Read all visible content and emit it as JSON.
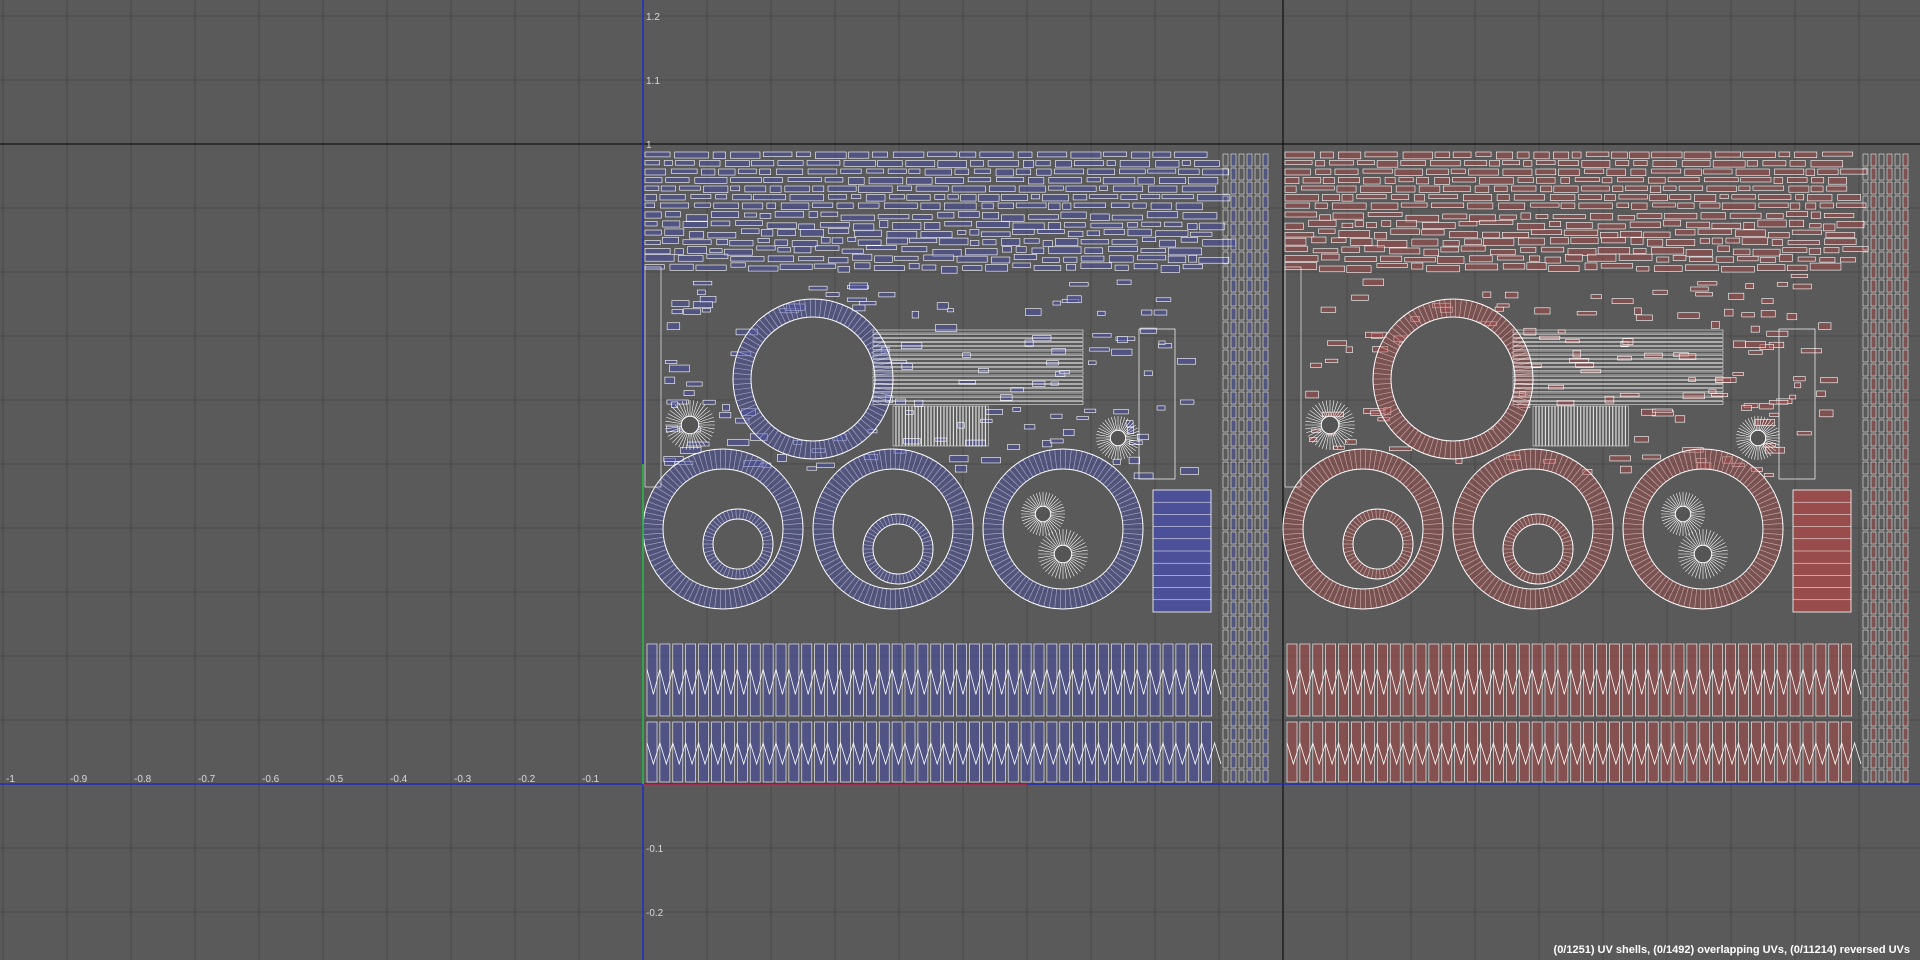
{
  "editor": {
    "view": "UV Texture Editor",
    "uv_axis_labels_u": [
      "-1",
      "-0.9",
      "-0.8",
      "-0.7",
      "-0.6",
      "-0.5",
      "-0.4",
      "-0.3",
      "-0.2",
      "-0.1"
    ],
    "uv_axis_labels_v_above": [
      "1.2",
      "1.1",
      "1"
    ],
    "uv_axis_labels_v_below": [
      "-0.1",
      "-0.2"
    ],
    "tiles": [
      {
        "name": "udim-1001",
        "color": "#4a4fa0",
        "line_color": "#ffffff"
      },
      {
        "name": "udim-1002",
        "color": "#a04a4a",
        "line_color": "#ffffff"
      }
    ],
    "accent_colors": {
      "u_axis": "#1f2dbf",
      "v_axis": "#1f2dbf",
      "green_axis": "#2cc63a",
      "red_axis": "#c62c2c",
      "grid_line": "#4a4a4a",
      "tile_border": "#1e1e1e",
      "background": "#5a5a5a"
    }
  },
  "status": {
    "text": "(0/1251) UV shells, (0/1492) overlapping UVs, (0/11214) reversed UVs"
  }
}
